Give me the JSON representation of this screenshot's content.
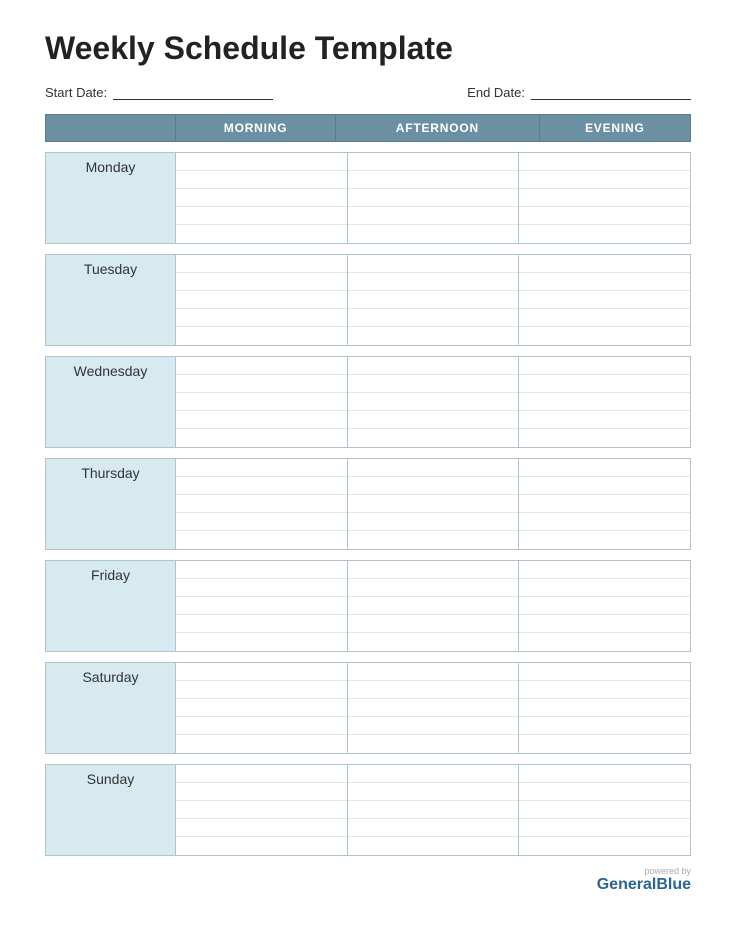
{
  "title": "Weekly Schedule Template",
  "start_date_label": "Start Date:",
  "end_date_label": "End Date:",
  "header_cols": [
    "",
    "MORNING",
    "AFTERNOON",
    "EVENING"
  ],
  "days": [
    {
      "name": "Monday"
    },
    {
      "name": "Tuesday"
    },
    {
      "name": "Wednesday"
    },
    {
      "name": "Thursday"
    },
    {
      "name": "Friday"
    },
    {
      "name": "Saturday"
    },
    {
      "name": "Sunday"
    }
  ],
  "lines_per_day": 5,
  "footer": {
    "powered_by": "powered by",
    "brand": "GeneralBlue"
  },
  "colors": {
    "header_bg": "#6b8fa3",
    "day_label_bg": "#d6eaf0",
    "border": "#b0c4ce",
    "line": "#dde8ed"
  }
}
